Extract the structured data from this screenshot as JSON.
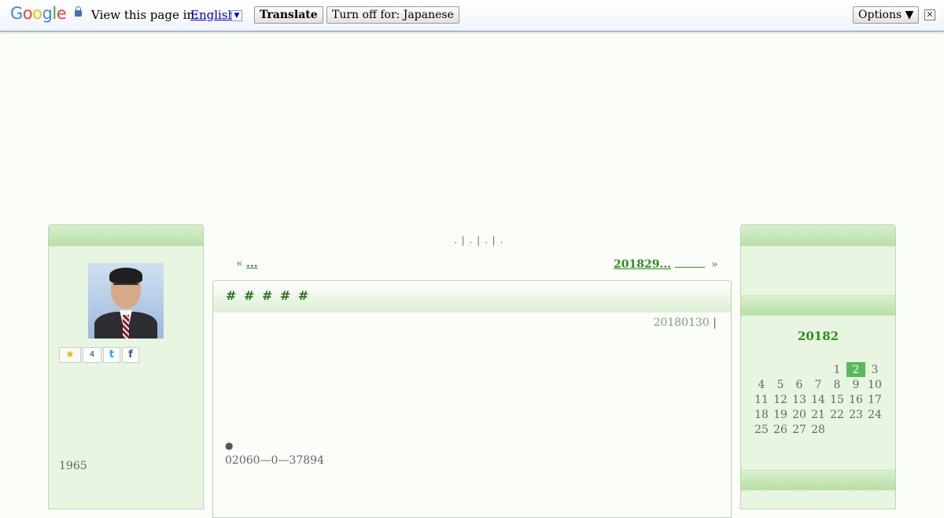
{
  "translate_bar": {
    "logo": "Google",
    "view_text": "View this page in:",
    "language": "English",
    "translate_label": "Translate",
    "turn_off_label": "Turn off for: Japanese",
    "options_label": "Options ▼",
    "close_glyph": "✕"
  },
  "center": {
    "top_nav": ". | . | . | .",
    "prev_arrow": "«",
    "prev_link": "...",
    "next_link": "201829...",
    "next_arrow": "»",
    "entry": {
      "title": "# # # # #",
      "date": "20180130",
      "date_sep": "|",
      "bullet": "●",
      "phone": "02060—0—37894"
    }
  },
  "left_sidebar": {
    "share": {
      "star": "★",
      "count": "4",
      "twitter": "t",
      "facebook": "f"
    },
    "birth_year": "1965"
  },
  "right_sidebar": {
    "calendar": {
      "title": "20182",
      "today": 2,
      "weeks": [
        [
          "",
          "",
          "",
          "",
          "1",
          "2",
          "3"
        ],
        [
          "4",
          "5",
          "6",
          "7",
          "8",
          "9",
          "10"
        ],
        [
          "11",
          "12",
          "13",
          "14",
          "15",
          "16",
          "17"
        ],
        [
          "18",
          "19",
          "20",
          "21",
          "22",
          "23",
          "24"
        ],
        [
          "25",
          "26",
          "27",
          "28",
          "",
          "",
          ""
        ]
      ]
    }
  },
  "colors": {
    "accent_green": "#2e8b1e",
    "sidebar_bg": "#e8f6e1",
    "today_bg": "#5cb85c"
  }
}
